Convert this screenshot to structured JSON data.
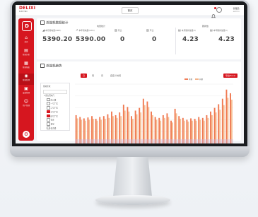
{
  "header": {
    "brand": "DELIXI",
    "brand_sub": "ELECTRIC",
    "center_button": "首页",
    "user_name": "管理员",
    "user_role": "admin"
  },
  "sidebar": {
    "items": [
      {
        "label": "首页",
        "icon": "home-icon"
      },
      {
        "label": "能耗分析",
        "icon": "chart-icon"
      },
      {
        "label": "能耗报表",
        "icon": "report-icon"
      },
      {
        "label": "能耗监测",
        "icon": "monitor-icon"
      },
      {
        "label": "设备管理",
        "icon": "device-icon"
      },
      {
        "label": "用户管理",
        "icon": "user-icon"
      }
    ]
  },
  "overview": {
    "title": "总能耗数据统计",
    "group_left": "电量统计",
    "group_right": "碳排放",
    "stats": [
      {
        "label": "本月用电量(kWh)",
        "value": "5390.20"
      },
      {
        "label": "本年用电量(kWh)",
        "value": "5390.00"
      },
      {
        "label": "同比",
        "value": "0"
      },
      {
        "label": "环比",
        "value": "0"
      },
      {
        "label": "本月碳排放量(t)",
        "value": "4.23"
      },
      {
        "label": "本年碳排放量(t)",
        "value": "4.23"
      }
    ]
  },
  "trend": {
    "title": "总能耗趋势",
    "tabs": [
      "日",
      "周",
      "月",
      "自定义时间"
    ],
    "active_tab": 0,
    "export_label": "导出Excel",
    "tree_title": "能耗区域",
    "tree_root": "全部区域",
    "tree_nodes": [
      {
        "label": "德力西电气",
        "checked": false,
        "root": true
      },
      {
        "label": "办公楼",
        "checked": false
      },
      {
        "label": "一号厂房",
        "checked": false
      },
      {
        "label": "二号厂房",
        "checked": false
      },
      {
        "label": "三号厂房",
        "checked": true
      },
      {
        "label": "四号厂房",
        "checked": true
      },
      {
        "label": "仓库",
        "checked": false
      },
      {
        "label": "食堂",
        "checked": false
      },
      {
        "label": "宿舍楼",
        "checked": false
      }
    ],
    "legend": [
      "本期",
      "同期"
    ]
  },
  "chart_data": {
    "type": "bar",
    "series": [
      {
        "name": "本期",
        "color": "#f07a52",
        "values": [
          62,
          58,
          55,
          57,
          60,
          54,
          58,
          60,
          64,
          70,
          62,
          68,
          85,
          80,
          60,
          72,
          78,
          98,
          92,
          70,
          58,
          56,
          62,
          66,
          50,
          76,
          60,
          56,
          52,
          55,
          54,
          58,
          56,
          62,
          70,
          78,
          86,
          98,
          118,
          110
        ]
      },
      {
        "name": "同期",
        "color": "#f5bf96",
        "values": [
          55,
          52,
          50,
          52,
          54,
          50,
          52,
          54,
          56,
          60,
          56,
          60,
          72,
          70,
          54,
          64,
          68,
          84,
          80,
          62,
          52,
          50,
          56,
          58,
          46,
          66,
          54,
          50,
          48,
          50,
          50,
          52,
          50,
          56,
          62,
          68,
          74,
          84,
          100,
          96
        ]
      }
    ],
    "ylim": [
      0,
      130
    ]
  }
}
